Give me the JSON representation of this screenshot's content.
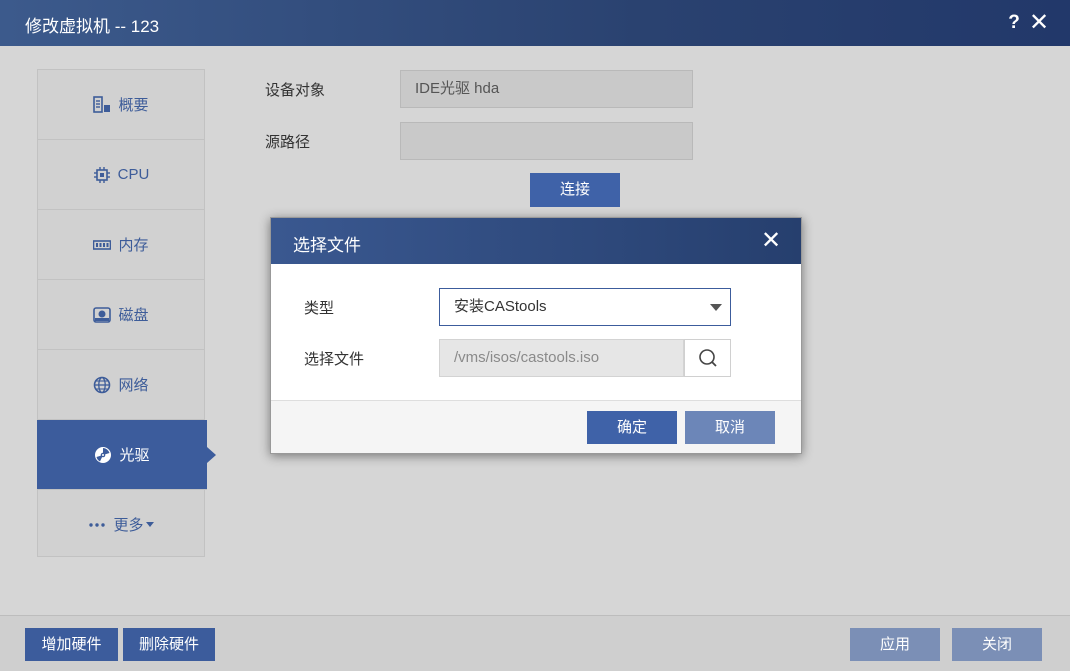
{
  "window": {
    "title": "修改虚拟机 -- 123",
    "help_label": "?",
    "close_label": "✕"
  },
  "nav": {
    "items": [
      {
        "label": "概要",
        "icon": "summary-icon"
      },
      {
        "label": "CPU",
        "icon": "cpu-icon"
      },
      {
        "label": "内存",
        "icon": "memory-icon"
      },
      {
        "label": "磁盘",
        "icon": "disk-icon"
      },
      {
        "label": "网络",
        "icon": "globe-icon"
      },
      {
        "label": "光驱",
        "icon": "cdrom-icon",
        "active": true
      },
      {
        "label": "更多",
        "icon": "dots-icon"
      }
    ]
  },
  "form": {
    "device_label": "设备对象",
    "device_value": "IDE光驱 hda",
    "source_label": "源路径",
    "source_value": "",
    "connect_label": "连接"
  },
  "footer": {
    "add_hw": "增加硬件",
    "remove_hw": "删除硬件",
    "apply": "应用",
    "close": "关闭"
  },
  "dialog": {
    "title": "选择文件",
    "close_label": "✕",
    "type_label": "类型",
    "type_value": "安装CAStools",
    "file_label": "选择文件",
    "file_placeholder": "/vms/isos/castools.iso",
    "ok_label": "确定",
    "cancel_label": "取消"
  },
  "colors": {
    "accent": "#3c5c9c",
    "titlebar": "#2a4270",
    "muted_button": "#7b8fb6"
  }
}
